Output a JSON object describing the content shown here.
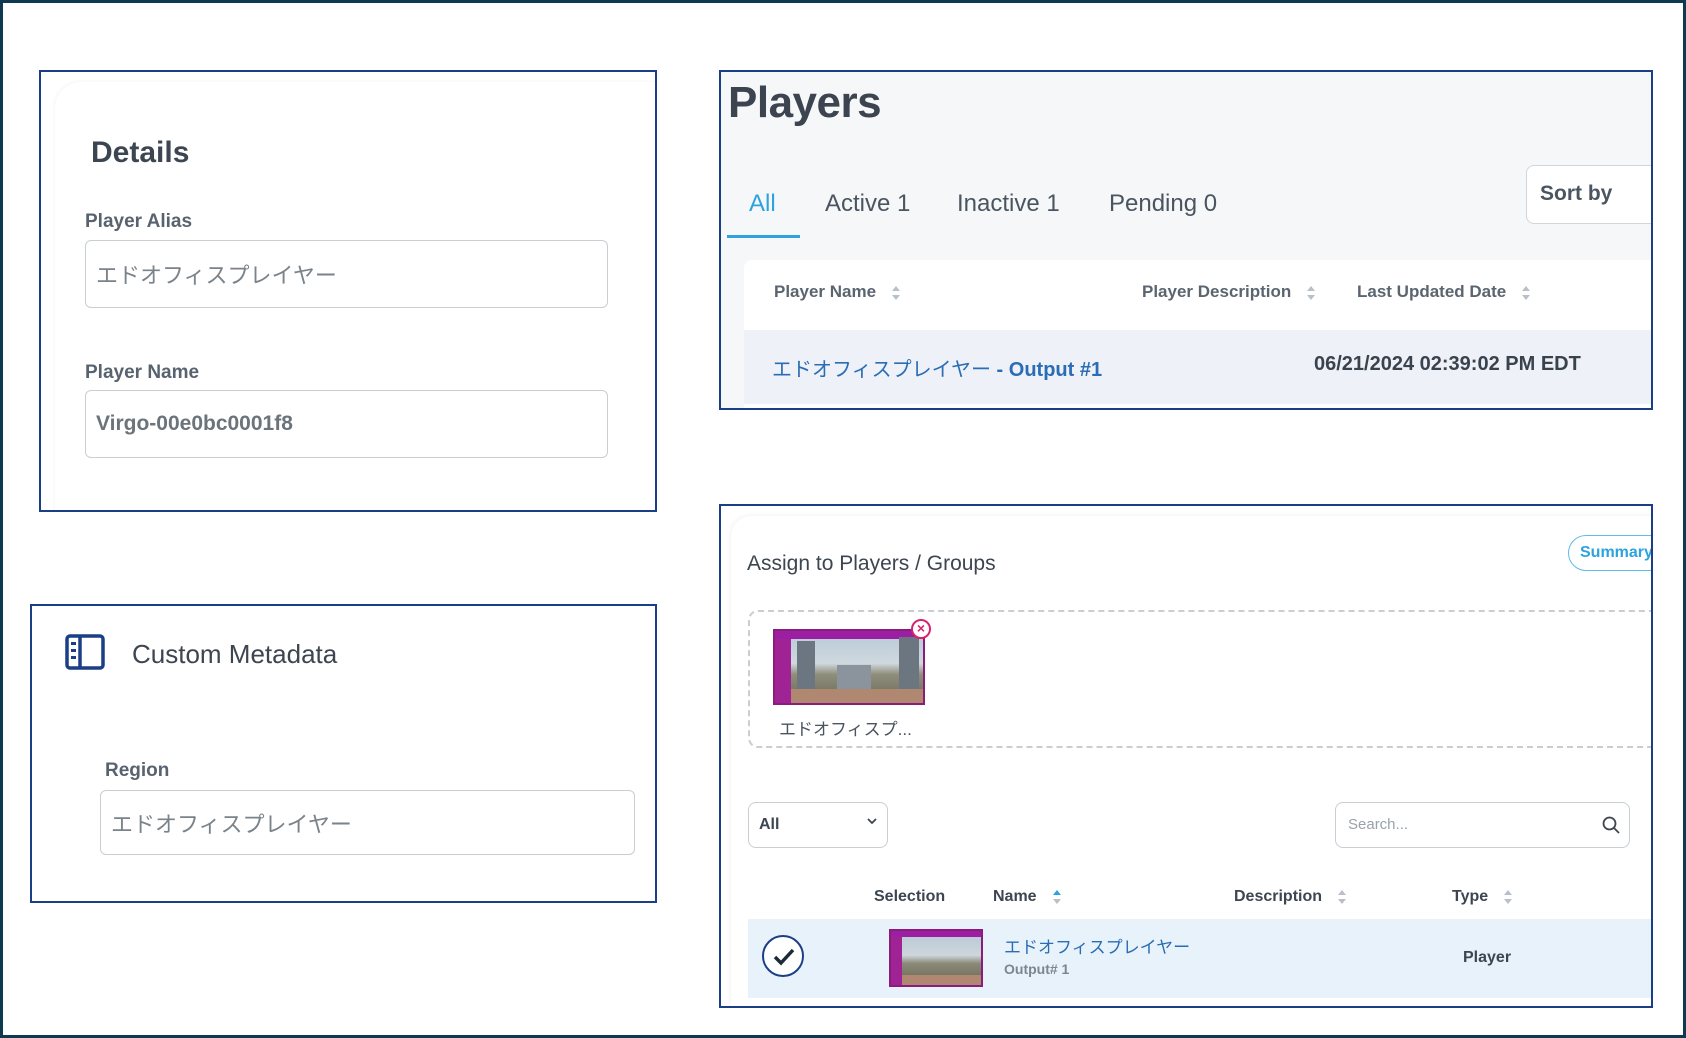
{
  "details": {
    "title": "Details",
    "player_alias_label": "Player Alias",
    "player_alias_value": "エドオフィスプレイヤー",
    "player_name_label": "Player Name",
    "player_name_value": "Virgo-00e0bc0001f8"
  },
  "custom_metadata": {
    "title": "Custom Metadata",
    "icon": "sidebar-panel-icon",
    "region_label": "Region",
    "region_value": "エドオフィスプレイヤー"
  },
  "players": {
    "title": "Players",
    "tabs": [
      {
        "label": "All",
        "active": true
      },
      {
        "label": "Active 1",
        "active": false
      },
      {
        "label": "Inactive 1",
        "active": false
      },
      {
        "label": "Pending 0",
        "active": false
      }
    ],
    "sort_by": "Sort by",
    "columns": [
      "Player Name",
      "Player Description",
      "Last Updated Date"
    ],
    "rows": [
      {
        "name": "エドオフィスプレイヤー",
        "output": " - Output #1",
        "description": "",
        "last_updated": "06/21/2024 02:39:02 PM EDT"
      }
    ]
  },
  "assign": {
    "title": "Assign to Players / Groups",
    "summary_button": "Summary",
    "selected_cards": [
      {
        "label": "エドオフィスプ...",
        "remove_icon": "close-circle-icon"
      }
    ],
    "filter_select": "All",
    "search_placeholder": "Search...",
    "columns": [
      "Selection",
      "Name",
      "Description",
      "Type"
    ],
    "rows": [
      {
        "name": "エドオフィスプレイヤー",
        "sub": "Output# 1",
        "description": "",
        "type": "Player",
        "selected": true
      }
    ]
  },
  "colors": {
    "panel_border": "#1b3f86",
    "accent": "#2da3de",
    "link": "#2a6db4",
    "remove": "#d9226f"
  }
}
